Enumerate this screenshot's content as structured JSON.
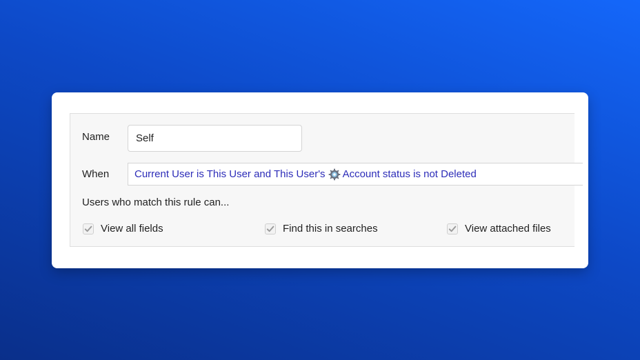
{
  "rule": {
    "name_label": "Name",
    "name_value": "Self",
    "when_label": "When",
    "condition_part1": "Current User is This User and This User's",
    "condition_icon": "gear-icon",
    "condition_part2": "Account status is not Deleted",
    "match_text": "Users who match this rule can...",
    "permissions": [
      {
        "label": "View all fields",
        "checked": true
      },
      {
        "label": "Find this in searches",
        "checked": true
      },
      {
        "label": "View attached files",
        "checked": true
      }
    ]
  },
  "colors": {
    "condition_text": "#2c2cb8",
    "check_mark": "#9a9a9a"
  }
}
